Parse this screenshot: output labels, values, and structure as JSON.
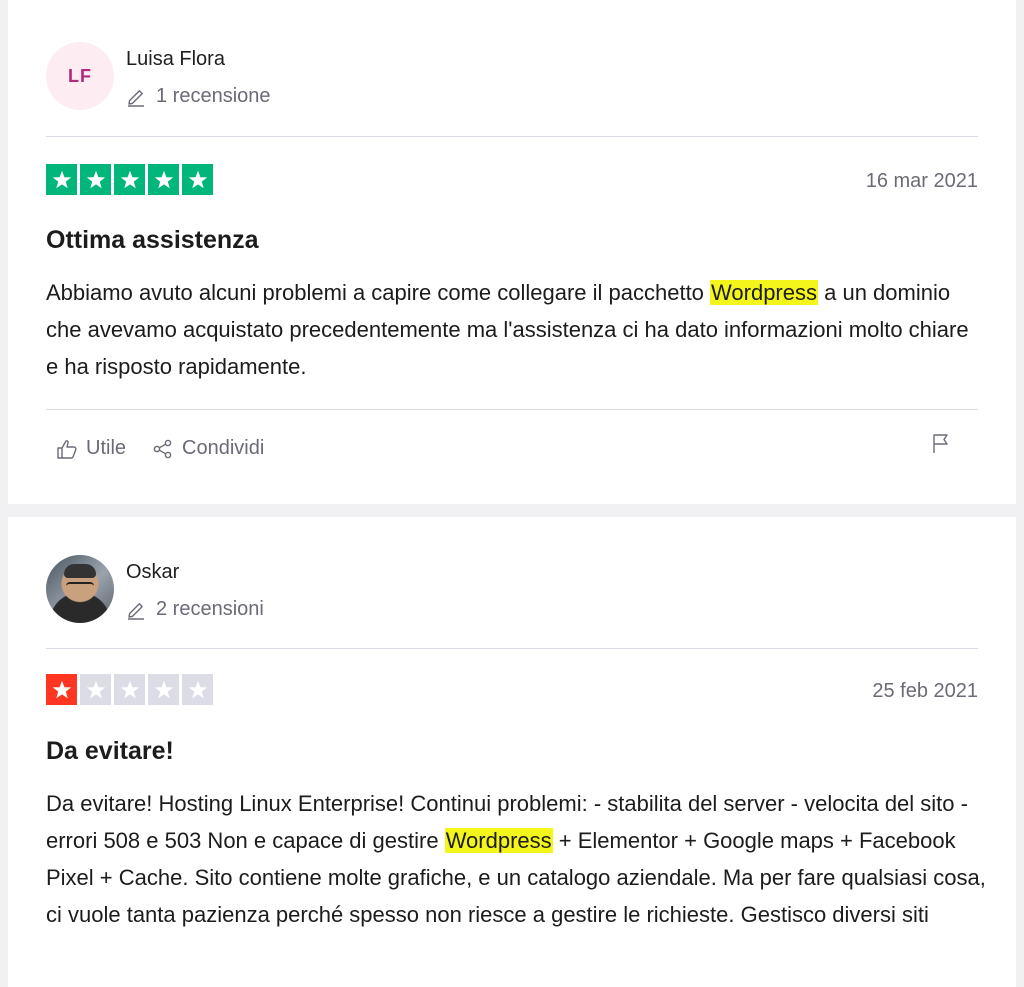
{
  "reviews": [
    {
      "author": "Luisa Flora",
      "initials": "LF",
      "review_count": "1 recensione",
      "rating": 5,
      "date": "16 mar 2021",
      "title": "Ottima assistenza",
      "body_parts": [
        "Abbiamo avuto alcuni problemi a capire come collegare il pacchetto ",
        "Wordpress",
        " a un dominio che avevamo acquistato precedentemente ma l'assistenza ci ha dato informazioni molto chiare e ha risposto rapidamente."
      ],
      "actions": {
        "useful": "Utile",
        "share": "Condividi"
      }
    },
    {
      "author": "Oskar",
      "review_count": "2 recensioni",
      "rating": 1,
      "date": "25 feb 2021",
      "title": "Da evitare!",
      "body_parts": [
        "Da evitare! Hosting Linux Enterprise! Continui problemi: - stabilita del server - velocita del sito - errori 508 e 503 Non e capace di gestire ",
        "Wordpress",
        " + Elementor + Google maps + Facebook Pixel + Cache. Sito contiene molte grafiche, e un catalogo aziendale. Ma per fare qualsiasi cosa, ci vuole tanta pazienza perché spesso non riesce a gestire le richieste. Gestisco diversi siti"
      ]
    }
  ],
  "colors": {
    "star_5": "#00b67a",
    "star_1": "#ff3722",
    "star_empty": "#dcdce6",
    "highlight": "#f4f51a"
  },
  "icons": [
    "pencil-icon",
    "star-icon",
    "thumbs-up-icon",
    "share-icon",
    "flag-icon"
  ]
}
